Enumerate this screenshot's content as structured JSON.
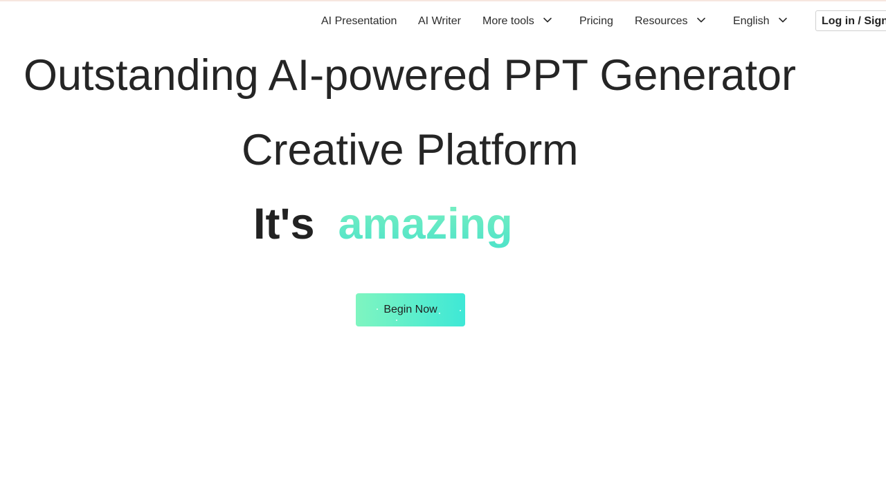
{
  "nav": {
    "items": [
      {
        "label": "AI Presentation",
        "has_dropdown": false
      },
      {
        "label": "AI Writer",
        "has_dropdown": false
      },
      {
        "label": "More tools",
        "has_dropdown": true
      },
      {
        "label": "Pricing",
        "has_dropdown": false
      },
      {
        "label": "Resources",
        "has_dropdown": true
      }
    ],
    "language": {
      "label": "English",
      "has_dropdown": true
    },
    "login_label": "Log in / Sign"
  },
  "hero": {
    "line1": "Outstanding AI-powered PPT Generator",
    "line2": "Creative Platform",
    "line3_prefix": "It's",
    "line3_highlight": "amazing",
    "cta_label": "Begin Now"
  },
  "colors": {
    "text": "#252525",
    "accent_start": "#7ff5c0",
    "accent_end": "#3ee8d6",
    "top_accent": "#f6e6df"
  },
  "icons": {
    "dropdown": "chevron-down-icon"
  }
}
